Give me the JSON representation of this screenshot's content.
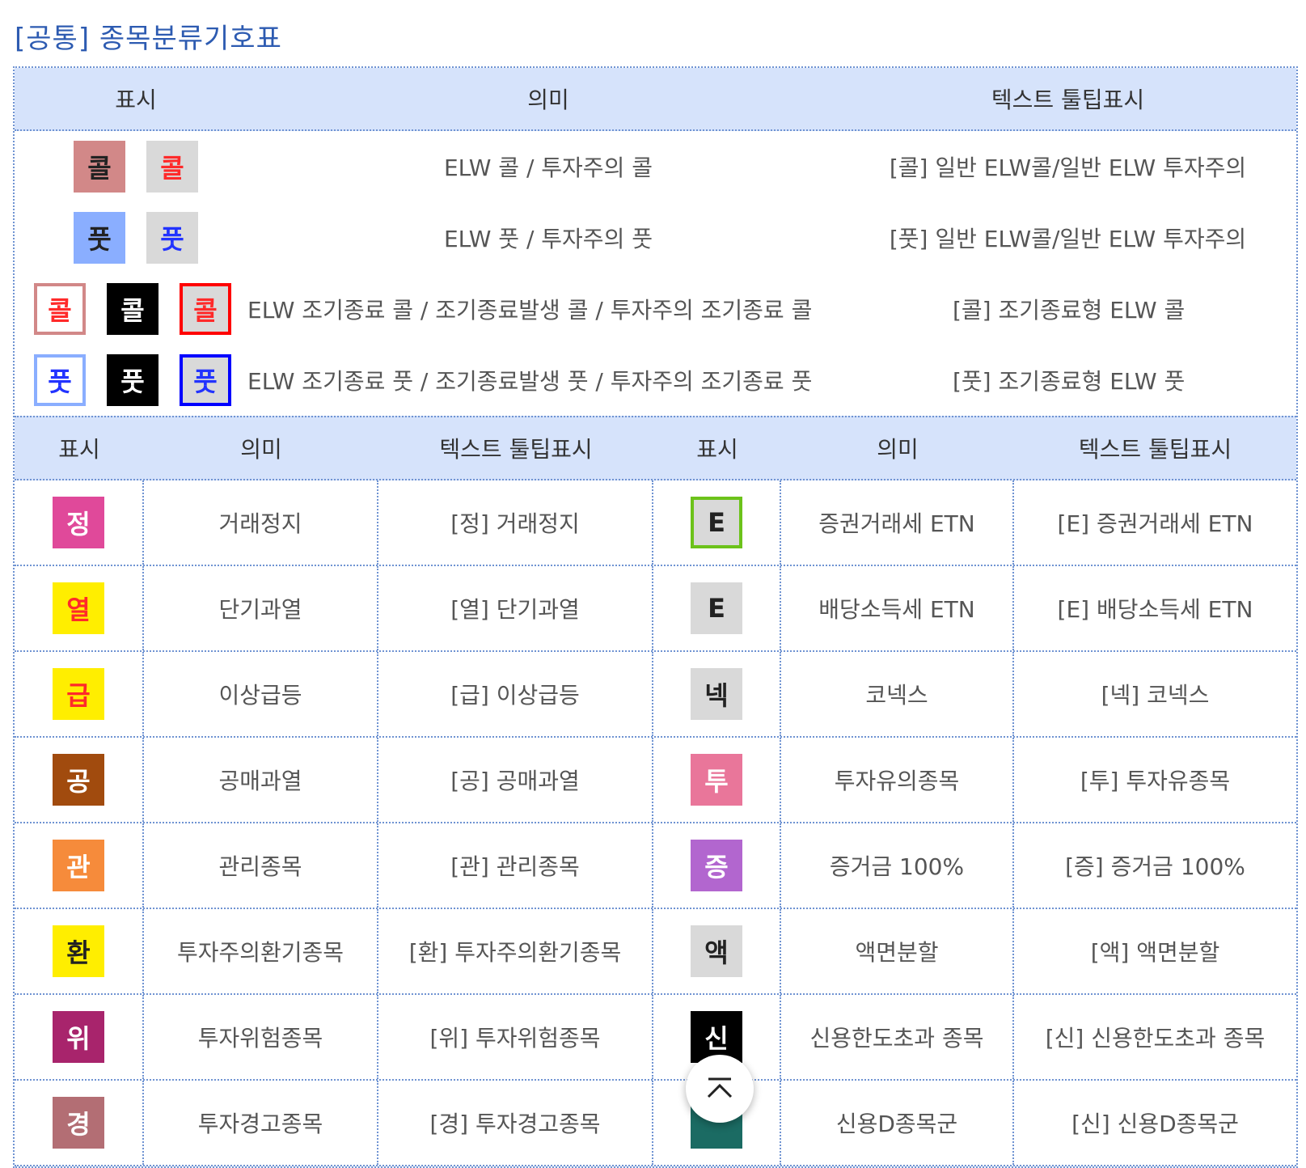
{
  "title": "[공통] 종목분류기호표",
  "top_header": [
    "표시",
    "의미",
    "텍스트 툴팁표시"
  ],
  "top_rows": [
    {
      "badges": [
        {
          "text": "콜",
          "bg": "#d28888",
          "fg": "#222222",
          "border": ""
        },
        {
          "text": "콜",
          "bg": "#d9d9d9",
          "fg": "#ff2a2a",
          "border": ""
        }
      ],
      "meaning": "ELW 콜 / 투자주의 콜",
      "tooltip": "[콜] 일반 ELW콜/일반 ELW 투자주의"
    },
    {
      "badges": [
        {
          "text": "풋",
          "bg": "#8aaeff",
          "fg": "#222222",
          "border": ""
        },
        {
          "text": "풋",
          "bg": "#d9d9d9",
          "fg": "#2233ff",
          "border": ""
        }
      ],
      "meaning": "ELW 풋 / 투자주의 풋",
      "tooltip": "[풋] 일반 ELW콜/일반 ELW 투자주의"
    },
    {
      "badges": [
        {
          "text": "콜",
          "bg": "#ffffff",
          "fg": "#ff2a2a",
          "border": "#d28888"
        },
        {
          "text": "콜",
          "bg": "#000000",
          "fg": "#ffffff",
          "border": ""
        },
        {
          "text": "콜",
          "bg": "#d9d9d9",
          "fg": "#ff2a2a",
          "border": "#ff0000"
        }
      ],
      "meaning": "ELW 조기종료 콜 / 조기종료발생 콜 / 투자주의 조기종료 콜",
      "tooltip": "[콜] 조기종료형 ELW 콜"
    },
    {
      "badges": [
        {
          "text": "풋",
          "bg": "#ffffff",
          "fg": "#2233ff",
          "border": "#8aaeff"
        },
        {
          "text": "풋",
          "bg": "#000000",
          "fg": "#ffffff",
          "border": ""
        },
        {
          "text": "풋",
          "bg": "#d9d9d9",
          "fg": "#2233ff",
          "border": "#0000ff"
        }
      ],
      "meaning": "ELW 조기종료 풋 / 조기종료발생 풋 / 투자주의 조기종료 풋",
      "tooltip": "[풋] 조기종료형 ELW 풋"
    }
  ],
  "sub_header": [
    "표시",
    "의미",
    "텍스트 툴팁표시",
    "표시",
    "의미",
    "텍스트 툴팁표시"
  ],
  "grid_rows": [
    {
      "left": {
        "badge": {
          "text": "정",
          "bg": "#e0499a",
          "fg": "#ffffff",
          "border": ""
        },
        "meaning": "거래정지",
        "tooltip": "[정] 거래정지"
      },
      "right": {
        "badge": {
          "text": "E",
          "bg": "#d9d9d9",
          "fg": "#222222",
          "border": "#6cc21a"
        },
        "meaning": "증권거래세 ETN",
        "tooltip": "[E] 증권거래세 ETN"
      }
    },
    {
      "left": {
        "badge": {
          "text": "열",
          "bg": "#ffee00",
          "fg": "#ff2a2a",
          "border": ""
        },
        "meaning": "단기과열",
        "tooltip": "[열] 단기과열"
      },
      "right": {
        "badge": {
          "text": "E",
          "bg": "#d9d9d9",
          "fg": "#222222",
          "border": ""
        },
        "meaning": "배당소득세 ETN",
        "tooltip": "[E] 배당소득세 ETN"
      }
    },
    {
      "left": {
        "badge": {
          "text": "급",
          "bg": "#ffee00",
          "fg": "#ff2a2a",
          "border": ""
        },
        "meaning": "이상급등",
        "tooltip": "[급] 이상급등"
      },
      "right": {
        "badge": {
          "text": "넥",
          "bg": "#d9d9d9",
          "fg": "#222222",
          "border": ""
        },
        "meaning": "코넥스",
        "tooltip": "[넥] 코넥스"
      }
    },
    {
      "left": {
        "badge": {
          "text": "공",
          "bg": "#a14b0e",
          "fg": "#ffffff",
          "border": ""
        },
        "meaning": "공매과열",
        "tooltip": "[공] 공매과열"
      },
      "right": {
        "badge": {
          "text": "투",
          "bg": "#e9769a",
          "fg": "#ffffff",
          "border": ""
        },
        "meaning": "투자유의종목",
        "tooltip": "[투] 투자유종목"
      }
    },
    {
      "left": {
        "badge": {
          "text": "관",
          "bg": "#f68b3b",
          "fg": "#ffffff",
          "border": ""
        },
        "meaning": "관리종목",
        "tooltip": "[관] 관리종목"
      },
      "right": {
        "badge": {
          "text": "증",
          "bg": "#b266cf",
          "fg": "#ffffff",
          "border": ""
        },
        "meaning": "증거금 100%",
        "tooltip": "[증] 증거금 100%"
      }
    },
    {
      "left": {
        "badge": {
          "text": "환",
          "bg": "#ffee00",
          "fg": "#222222",
          "border": ""
        },
        "meaning": "투자주의환기종목",
        "tooltip": "[환] 투자주의환기종목"
      },
      "right": {
        "badge": {
          "text": "액",
          "bg": "#d9d9d9",
          "fg": "#222222",
          "border": ""
        },
        "meaning": "액면분할",
        "tooltip": "[액] 액면분할"
      }
    },
    {
      "left": {
        "badge": {
          "text": "위",
          "bg": "#a8246c",
          "fg": "#ffffff",
          "border": ""
        },
        "meaning": "투자위험종목",
        "tooltip": "[위] 투자위험종목"
      },
      "right": {
        "badge": {
          "text": "신",
          "bg": "#000000",
          "fg": "#ffffff",
          "border": ""
        },
        "meaning": "신용한도초과 종목",
        "tooltip": "[신] 신용한도초과 종목"
      }
    },
    {
      "left": {
        "badge": {
          "text": "경",
          "bg": "#b36e74",
          "fg": "#ffffff",
          "border": ""
        },
        "meaning": "투자경고종목",
        "tooltip": "[경] 투자경고종목"
      },
      "right": {
        "badge": {
          "text": "",
          "bg": "#1b6b63",
          "fg": "#ffffff",
          "border": ""
        },
        "meaning": "신용D종목군",
        "tooltip": "[신] 신용D종목군"
      }
    }
  ],
  "scroll_top_icon": "chevron-up-icon"
}
